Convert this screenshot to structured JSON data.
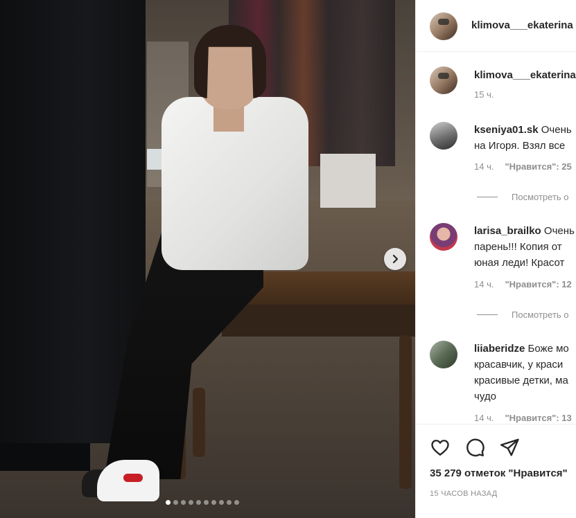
{
  "post": {
    "username": "klimova___ekaterina",
    "caption_time": "15 ч.",
    "likes_text": "35 279 отметок \"Нравится\"",
    "posted_ago": "15 ЧАСОВ НАЗАД",
    "carousel": {
      "total_slides": 10,
      "current_slide": 1
    }
  },
  "comments": [
    {
      "username": "kseniya01.sk",
      "text_lines": [
        "Очень",
        "на Игоря. Взял все"
      ],
      "time": "14 ч.",
      "likes": "\"Нравится\": 25",
      "replies": "Посмотреть о"
    },
    {
      "username": "larisa_brailko",
      "text_lines": [
        "Очень",
        "парень!!! Копия от",
        "юная леди! Красот"
      ],
      "time": "14 ч.",
      "likes": "\"Нравится\": 12",
      "replies": "Посмотреть о"
    },
    {
      "username": "liiaberidze",
      "text_lines": [
        "Боже мо",
        "красавчик, у краси",
        "красивые детки, ма",
        "чудо"
      ],
      "time": "14 ч.",
      "likes": "\"Нравится\": 13"
    }
  ],
  "icons": {
    "like": "heart-icon",
    "comment": "comment-bubble-icon",
    "share": "paper-plane-icon",
    "next": "chevron-right-icon"
  },
  "colors": {
    "text": "#262626",
    "muted": "#8e8e8e",
    "border": "#efefef"
  }
}
